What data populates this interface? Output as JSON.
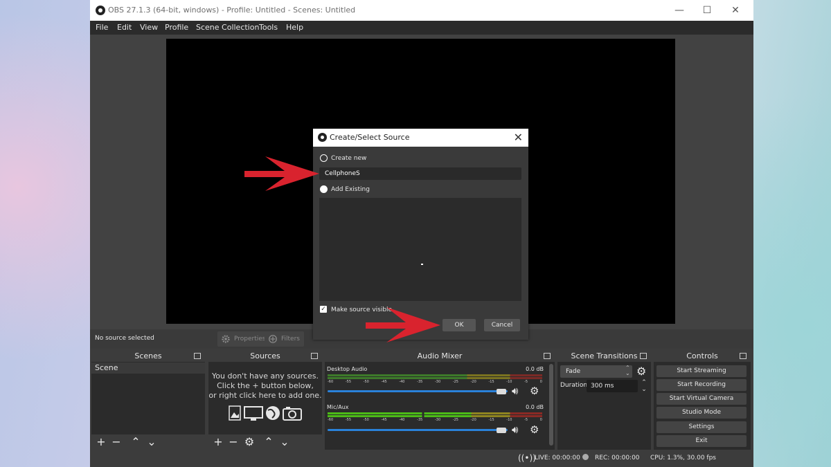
{
  "window": {
    "title": "OBS 27.1.3 (64-bit, windows) - Profile: Untitled - Scenes: Untitled",
    "minimize": "—",
    "maximize": "☐",
    "close": "✕"
  },
  "menu": [
    "File",
    "Edit",
    "View",
    "Profile",
    "Scene Collection",
    "Tools",
    "Help"
  ],
  "source_toolbar": {
    "status": "No source selected",
    "properties": "Properties",
    "filters": "Filters"
  },
  "docks": {
    "scenes": {
      "title": "Scenes",
      "items": [
        "Scene"
      ]
    },
    "sources": {
      "title": "Sources",
      "empty_line1": "You don't have any sources.",
      "empty_line2": "Click the + button below,",
      "empty_line3": "or right click here to add one."
    },
    "mixer": {
      "title": "Audio Mixer",
      "tracks": [
        {
          "name": "Desktop Audio",
          "level": "0.0 dB",
          "volume": 1.0
        },
        {
          "name": "Mic/Aux",
          "level": "0.0 dB",
          "volume": 1.0
        }
      ],
      "scale": [
        "-60",
        "-55",
        "-50",
        "-45",
        "-40",
        "-35",
        "-30",
        "-25",
        "-20",
        "-15",
        "-10",
        "-5",
        "0"
      ]
    },
    "transitions": {
      "title": "Scene Transitions",
      "selected": "Fade",
      "duration_label": "Duration",
      "duration_value": "300 ms"
    },
    "controls": {
      "title": "Controls",
      "buttons": [
        "Start Streaming",
        "Start Recording",
        "Start Virtual Camera",
        "Studio Mode",
        "Settings",
        "Exit"
      ]
    }
  },
  "status": {
    "live": "LIVE: 00:00:00",
    "rec": "REC: 00:00:00",
    "cpu": "CPU: 1.3%, 30.00 fps"
  },
  "dialog": {
    "title": "Create/Select Source",
    "create_new_label": "Create new",
    "name_value": "CellphoneS",
    "add_existing_label": "Add Existing",
    "make_visible_label": "Make source visible",
    "make_visible_checked": true,
    "ok": "OK",
    "cancel": "Cancel"
  },
  "colors": {
    "annotation_arrow": "#d9232e",
    "meter_green": "#4cbb17",
    "meter_yellow": "#c8b81a",
    "meter_red": "#c8312a",
    "volume_blue": "#2a82da"
  }
}
